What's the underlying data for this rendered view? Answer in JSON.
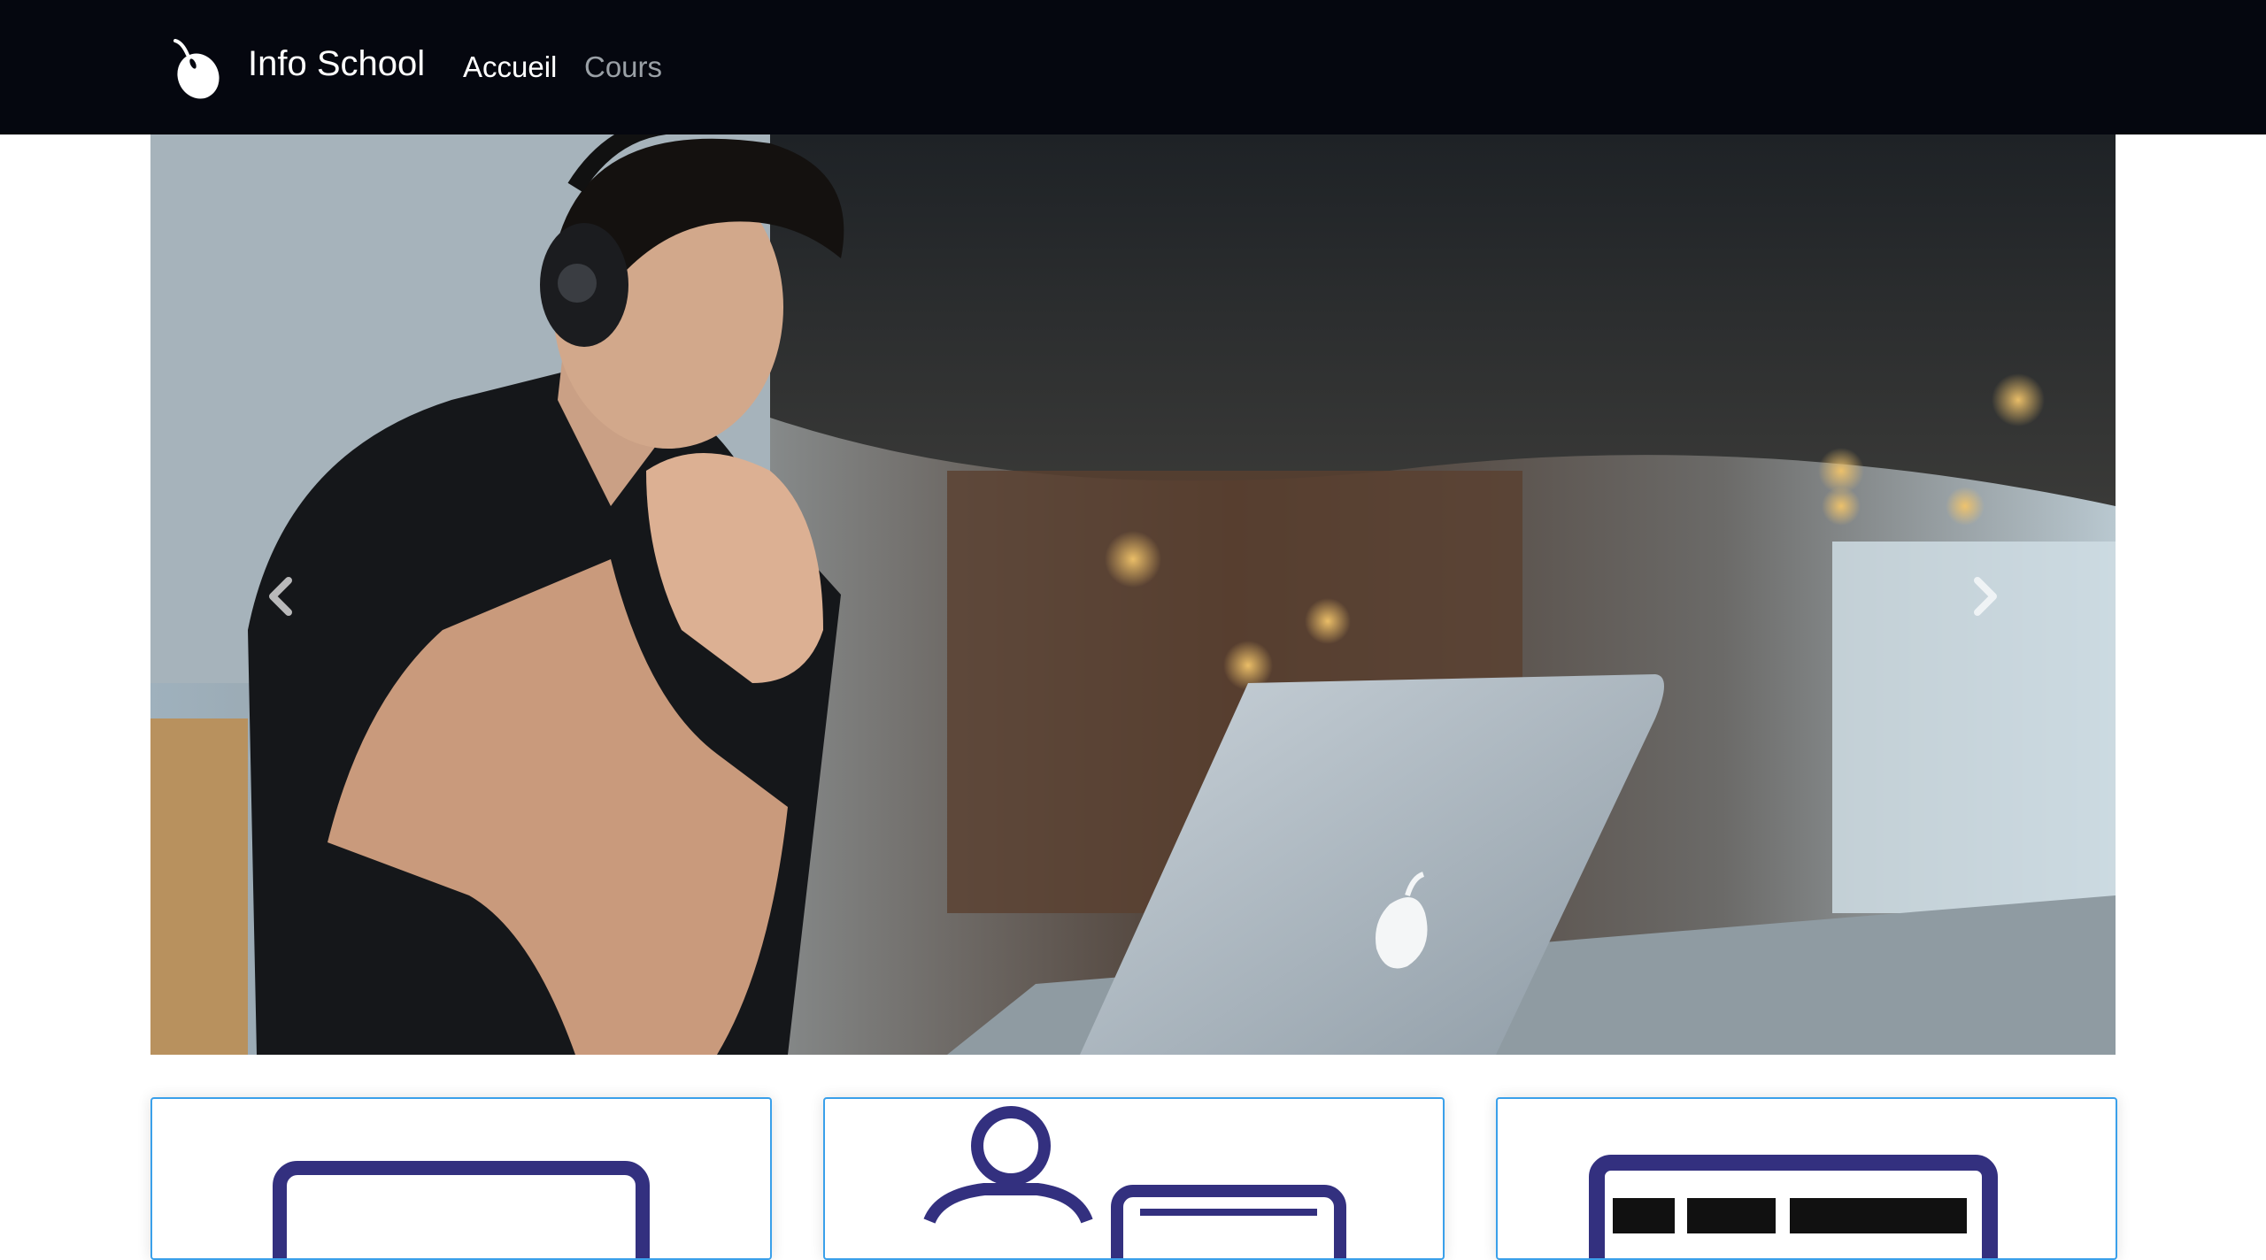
{
  "navbar": {
    "brand": "Info School",
    "links": [
      {
        "label": "Accueil",
        "active": true
      },
      {
        "label": "Cours",
        "active": false
      }
    ]
  },
  "carousel": {
    "prev_icon": "chevron-left-icon",
    "next_icon": "chevron-right-icon"
  },
  "cards": [
    {
      "icon": "monitor-icon"
    },
    {
      "icon": "teacher-board-icon"
    },
    {
      "icon": "job-board-icon"
    }
  ],
  "colors": {
    "navbar_bg": "#05070f",
    "card_border": "#3aa0ea",
    "icon_navy": "#33307f"
  }
}
